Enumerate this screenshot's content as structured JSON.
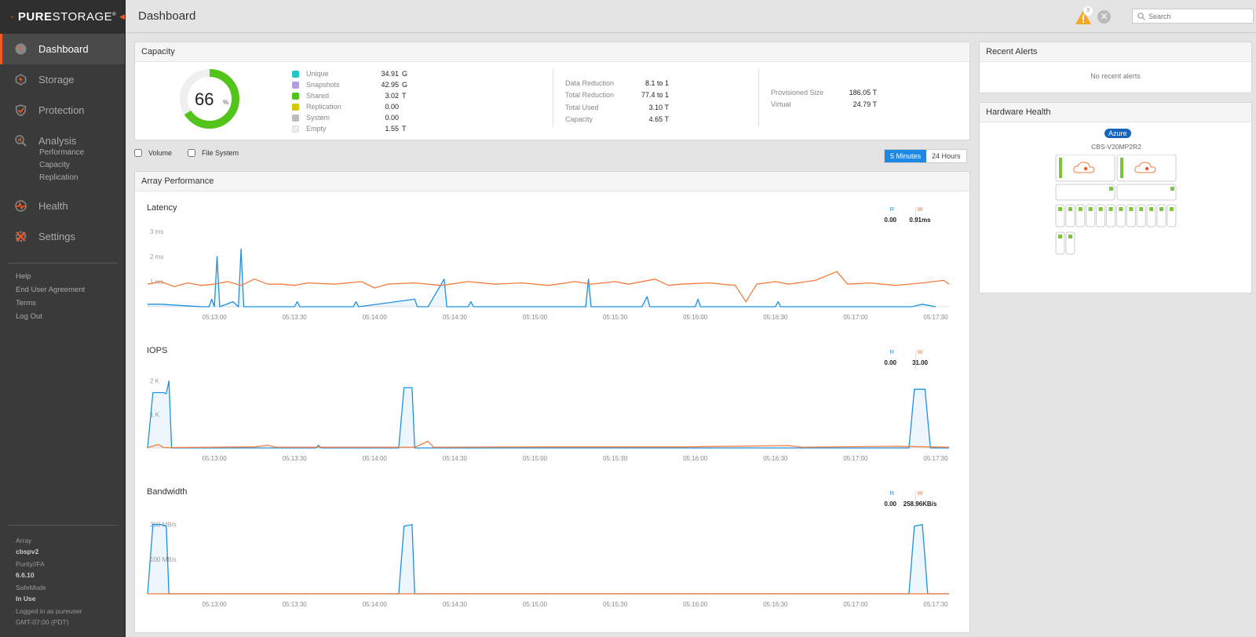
{
  "brand": {
    "word_bold": "PURE",
    "word": "STORAGE",
    "reg": "®",
    "accent": "#f15a22"
  },
  "sidebar": {
    "items": [
      {
        "label": "Dashboard",
        "icon": "dashboard-gauge-icon",
        "active": true
      },
      {
        "label": "Storage",
        "icon": "storage-bolt-icon"
      },
      {
        "label": "Protection",
        "icon": "protection-shield-icon"
      },
      {
        "label": "Analysis",
        "icon": "analysis-magnifier-icon",
        "sub": [
          "Performance",
          "Capacity",
          "Replication"
        ]
      },
      {
        "label": "Health",
        "icon": "health-heartbeat-icon"
      },
      {
        "label": "Settings",
        "icon": "settings-tools-icon"
      }
    ],
    "links": [
      "Help",
      "End User Agreement",
      "Terms",
      "Log Out"
    ],
    "info": [
      {
        "label": "Array",
        "value": "cbspv2"
      },
      {
        "label": "Purity//FA",
        "value": "6.6.10"
      },
      {
        "label": "SafeMode",
        "value": "In Use"
      }
    ],
    "login_line1": "Logged in as pureuser",
    "login_line2": "GMT-07:00 (PDT)"
  },
  "header": {
    "title": "Dashboard",
    "alert_count": "3",
    "search_placeholder": "Search"
  },
  "capacity": {
    "title": "Capacity",
    "percent": "66",
    "percent_sign": "%",
    "percent_value": 66,
    "legend": [
      {
        "name": "Unique",
        "value": "34.91",
        "unit": "G",
        "color": "#26c6c6"
      },
      {
        "name": "Snapshots",
        "value": "42.95",
        "unit": "G",
        "color": "#b39ddb"
      },
      {
        "name": "Shared",
        "value": "3.02",
        "unit": "T",
        "color": "#52c41a"
      },
      {
        "name": "Replication",
        "value": "0.00",
        "unit": "",
        "color": "#d4c800"
      },
      {
        "name": "System",
        "value": "0.00",
        "unit": "",
        "color": "#bdbdbd"
      },
      {
        "name": "Empty",
        "value": "1.55",
        "unit": "T",
        "color": "#eeeeee"
      }
    ],
    "reduction": [
      {
        "label": "Data Reduction",
        "value": "8.1 to 1"
      },
      {
        "label": "Total Reduction",
        "value": "77.4 to 1"
      },
      {
        "label": "Total Used",
        "value": "3.10 T"
      },
      {
        "label": "Capacity",
        "value": "4.65 T"
      }
    ],
    "provisioned": [
      {
        "label": "Provisioned Size",
        "value": "186.05 T"
      },
      {
        "label": "Virtual",
        "value": "24.79 T"
      }
    ]
  },
  "filters": {
    "volume": "Volume",
    "file_system": "File System"
  },
  "time_range": {
    "options": [
      "5 Minutes",
      "24 Hours"
    ],
    "selected": "5 Minutes"
  },
  "performance": {
    "title": "Array Performance",
    "read_color": "#1e90e0",
    "write_color": "#f47b3c",
    "charts": [
      {
        "title": "Latency",
        "r_label": "R",
        "w_label": "W",
        "r_value": "0.00",
        "w_value": "0.91ms"
      },
      {
        "title": "IOPS",
        "r_label": "R",
        "w_label": "W",
        "r_value": "0.00",
        "w_value": "31.00"
      },
      {
        "title": "Bandwidth",
        "r_label": "R",
        "w_label": "W",
        "r_value": "0.00",
        "w_value": "258.96KB/s"
      }
    ]
  },
  "chart_data": [
    {
      "type": "line",
      "title": "Latency",
      "x_ticks": [
        "05:13:00",
        "05:13:30",
        "05:14:00",
        "05:14:30",
        "05:15:00",
        "05:15:30",
        "05:16:00",
        "05:16:30",
        "05:17:00",
        "05:17:30"
      ],
      "y_ticks": [
        "1 ms",
        "2 ms",
        "3 ms"
      ],
      "ylim": [
        0,
        3
      ],
      "x_range_seconds": [
        0,
        300
      ],
      "series": [
        {
          "name": "R",
          "color": "#1e90e0",
          "points": [
            [
              0,
              0.1
            ],
            [
              5,
              0.1
            ],
            [
              20,
              0
            ],
            [
              23,
              0
            ],
            [
              24,
              0.3
            ],
            [
              25,
              0
            ],
            [
              26,
              2.0
            ],
            [
              27,
              0
            ],
            [
              32,
              0.2
            ],
            [
              34,
              0
            ],
            [
              35,
              2.3
            ],
            [
              36,
              0
            ],
            [
              55,
              0
            ],
            [
              56,
              0.2
            ],
            [
              57,
              0
            ],
            [
              77,
              0
            ],
            [
              78,
              0.2
            ],
            [
              79,
              0
            ],
            [
              100,
              0.3
            ],
            [
              101,
              0
            ],
            [
              105,
              0
            ],
            [
              111,
              1.1
            ],
            [
              112,
              0
            ],
            [
              120,
              0
            ],
            [
              121,
              0.2
            ],
            [
              122,
              0
            ],
            [
              164,
              0
            ],
            [
              165,
              1.1
            ],
            [
              166,
              0
            ],
            [
              185,
              0
            ],
            [
              187,
              0.4
            ],
            [
              188,
              0
            ],
            [
              205,
              0
            ],
            [
              206,
              0.3
            ],
            [
              207,
              0
            ],
            [
              235,
              0
            ],
            [
              236,
              0.2
            ],
            [
              237,
              0
            ],
            [
              286,
              0
            ],
            [
              290,
              0.1
            ],
            [
              295,
              0
            ]
          ]
        },
        {
          "name": "W",
          "color": "#f47b3c",
          "points": [
            [
              0,
              0.9
            ],
            [
              5,
              1.0
            ],
            [
              10,
              0.8
            ],
            [
              15,
              0.95
            ],
            [
              20,
              0.85
            ],
            [
              25,
              0.9
            ],
            [
              30,
              1.0
            ],
            [
              35,
              0.85
            ],
            [
              40,
              1.1
            ],
            [
              45,
              0.9
            ],
            [
              50,
              0.9
            ],
            [
              55,
              0.85
            ],
            [
              60,
              0.95
            ],
            [
              70,
              0.9
            ],
            [
              80,
              1.0
            ],
            [
              85,
              0.75
            ],
            [
              90,
              0.9
            ],
            [
              100,
              0.95
            ],
            [
              110,
              0.85
            ],
            [
              120,
              1.0
            ],
            [
              130,
              0.9
            ],
            [
              140,
              0.95
            ],
            [
              150,
              0.85
            ],
            [
              160,
              1.0
            ],
            [
              166,
              0.9
            ],
            [
              175,
              1.0
            ],
            [
              180,
              0.9
            ],
            [
              190,
              1.1
            ],
            [
              195,
              0.85
            ],
            [
              200,
              0.9
            ],
            [
              210,
              0.95
            ],
            [
              220,
              0.85
            ],
            [
              224,
              0.2
            ],
            [
              228,
              0.9
            ],
            [
              235,
              1.0
            ],
            [
              240,
              0.9
            ],
            [
              250,
              1.05
            ],
            [
              258,
              1.4
            ],
            [
              262,
              0.9
            ],
            [
              270,
              0.95
            ],
            [
              280,
              0.85
            ],
            [
              290,
              0.95
            ],
            [
              298,
              1.05
            ],
            [
              300,
              0.9
            ]
          ]
        }
      ]
    },
    {
      "type": "line",
      "title": "IOPS",
      "x_ticks": [
        "05:13:00",
        "05:13:30",
        "05:14:00",
        "05:14:30",
        "05:15:00",
        "05:15:30",
        "05:16:00",
        "05:16:30",
        "05:17:00",
        "05:17:30"
      ],
      "y_ticks": [
        "1 K",
        "2 K"
      ],
      "ylim": [
        0,
        2200
      ],
      "x_range_seconds": [
        0,
        300
      ],
      "series": [
        {
          "name": "R",
          "color": "#1e90e0",
          "points": [
            [
              0,
              0
            ],
            [
              2,
              1650
            ],
            [
              6,
              1650
            ],
            [
              7,
              1620
            ],
            [
              8,
              2000
            ],
            [
              9,
              0
            ],
            [
              63,
              0
            ],
            [
              64,
              80
            ],
            [
              65,
              0
            ],
            [
              94,
              0
            ],
            [
              96,
              1800
            ],
            [
              99,
              1800
            ],
            [
              100,
              0
            ],
            [
              285,
              0
            ],
            [
              287,
              1750
            ],
            [
              291,
              1750
            ],
            [
              293,
              0
            ],
            [
              300,
              0
            ]
          ]
        },
        {
          "name": "W",
          "color": "#f47b3c",
          "points": [
            [
              0,
              10
            ],
            [
              4,
              100
            ],
            [
              6,
              10
            ],
            [
              40,
              30
            ],
            [
              45,
              80
            ],
            [
              48,
              20
            ],
            [
              100,
              20
            ],
            [
              105,
              200
            ],
            [
              107,
              20
            ],
            [
              150,
              30
            ],
            [
              200,
              30
            ],
            [
              240,
              70
            ],
            [
              245,
              20
            ],
            [
              280,
              50
            ],
            [
              300,
              20
            ]
          ]
        }
      ]
    },
    {
      "type": "line",
      "title": "Bandwidth",
      "x_ticks": [
        "05:13:00",
        "05:13:30",
        "05:14:00",
        "05:14:30",
        "05:15:00",
        "05:15:30",
        "05:16:00",
        "05:16:30",
        "05:17:00",
        "05:17:30"
      ],
      "y_ticks": [
        "100 MB/s",
        "200 MB/s"
      ],
      "ylim": [
        0,
        215
      ],
      "x_range_seconds": [
        0,
        300
      ],
      "series": [
        {
          "name": "R",
          "color": "#1e90e0",
          "points": [
            [
              0,
              0
            ],
            [
              2,
              200
            ],
            [
              5,
              200
            ],
            [
              7,
              195
            ],
            [
              8,
              0
            ],
            [
              94,
              0
            ],
            [
              96,
              195
            ],
            [
              99,
              200
            ],
            [
              100,
              0
            ],
            [
              285,
              0
            ],
            [
              287,
              195
            ],
            [
              290,
              200
            ],
            [
              292,
              0
            ],
            [
              300,
              0
            ]
          ]
        },
        {
          "name": "W",
          "color": "#f47b3c",
          "points": [
            [
              0,
              0.3
            ],
            [
              300,
              0.3
            ]
          ]
        }
      ]
    }
  ],
  "alerts": {
    "title": "Recent Alerts",
    "empty_text": "No recent alerts"
  },
  "hardware": {
    "title": "Hardware Health",
    "cloud": "Azure",
    "name": "CBS-V20MP2R2",
    "status_color": "#7cc43a",
    "controllers": 2,
    "shelves": 2,
    "drives": 14
  }
}
